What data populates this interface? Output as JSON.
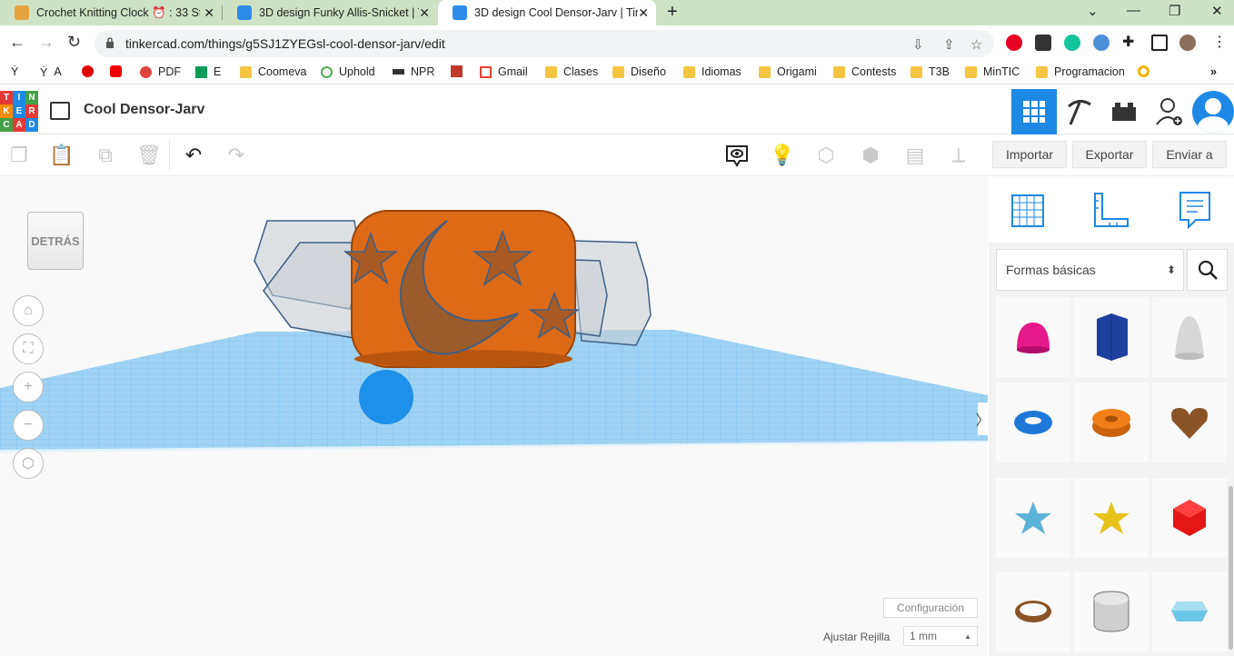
{
  "tabs": [
    {
      "label": "Crochet Knitting Clock ⏰ : 33 St",
      "icon_color": "#e8a341"
    },
    {
      "label": "3D design Funky Allis-Snicket | Ti",
      "icon_color": "#2d8ce8"
    },
    {
      "label": "3D design Cool Densor-Jarv | Tin",
      "icon_color": "#2d8ce8"
    }
  ],
  "address": {
    "url": "tinkercad.com/things/g5SJ1ZYEGsl-cool-densor-jarv/edit"
  },
  "bookmarks": [
    {
      "label": "A"
    },
    {
      "label": "PDF"
    },
    {
      "label": "E"
    },
    {
      "label": "Coomeva"
    },
    {
      "label": "Uphold"
    },
    {
      "label": "NPR"
    },
    {
      "label": "Gmail"
    },
    {
      "label": "Clases"
    },
    {
      "label": "Diseño"
    },
    {
      "label": "Idiomas"
    },
    {
      "label": "Origami"
    },
    {
      "label": "Contests"
    },
    {
      "label": "T3B"
    },
    {
      "label": "MinTIC"
    },
    {
      "label": "Programacion"
    }
  ],
  "app": {
    "logo_letters": [
      "TIN",
      "KER",
      "CAD"
    ],
    "design_title": "Cool Densor-Jarv"
  },
  "toolbar": {
    "import_label": "Importar",
    "export_label": "Exportar",
    "send_label": "Enviar a"
  },
  "viewcube": {
    "label": "DETRÁS"
  },
  "sidebar": {
    "category": "Formas básicas"
  },
  "footer": {
    "settings_label": "Configuración",
    "grid_label": "Ajustar Rejilla",
    "grid_value": "1 mm"
  }
}
